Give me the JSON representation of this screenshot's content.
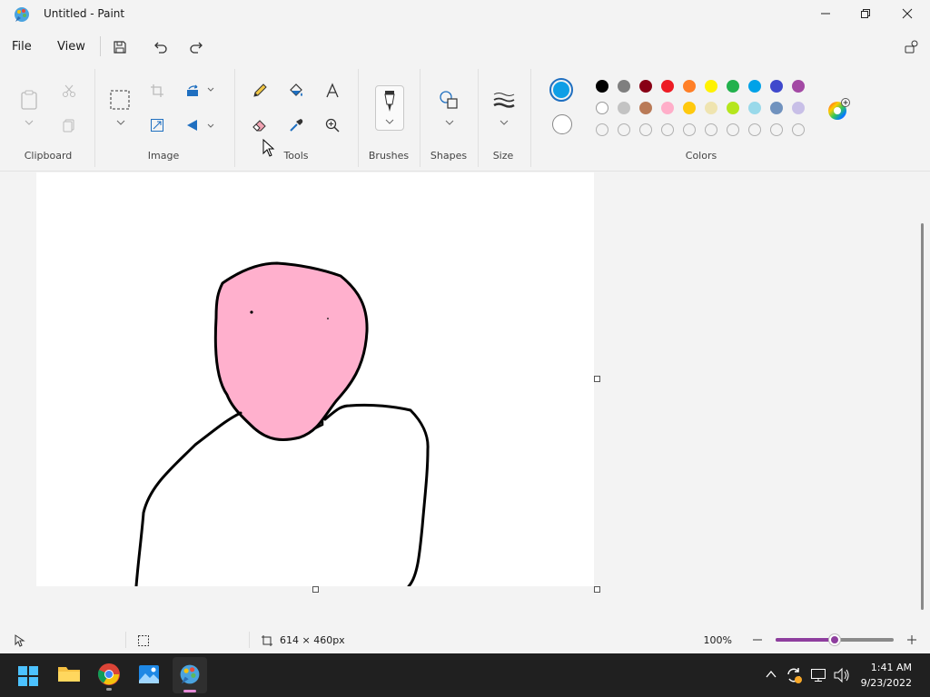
{
  "window": {
    "title": "Untitled - Paint"
  },
  "menu": {
    "file": "File",
    "view": "View"
  },
  "ribbon": {
    "groups": {
      "clipboard": "Clipboard",
      "image": "Image",
      "tools": "Tools",
      "brushes": "Brushes",
      "shapes": "Shapes",
      "size": "Size",
      "colors": "Colors"
    },
    "primary_color": "#0f9ee6",
    "secondary_color": "#ffffff",
    "palette_row1": [
      "#000000",
      "#7f7f7f",
      "#880015",
      "#ed1c24",
      "#ff7f27",
      "#fff200",
      "#22b14c",
      "#00a2e8",
      "#3f48cc",
      "#a349a4"
    ],
    "palette_row2": [
      "#ffffff",
      "#c3c3c3",
      "#b97a57",
      "#ffaec9",
      "#ffc90e",
      "#efe4b0",
      "#b5e61d",
      "#99d9ea",
      "#7092be",
      "#c8bfe7"
    ]
  },
  "canvas": {
    "fill": "#ffb0cd",
    "stroke": "#000000"
  },
  "status": {
    "canvas_size": "614 × 460px",
    "zoom": "100%",
    "zoom_level": 0.5,
    "accent": "#8e3e9e"
  },
  "taskbar": {
    "time": "1:41 AM",
    "date": "9/23/2022"
  }
}
